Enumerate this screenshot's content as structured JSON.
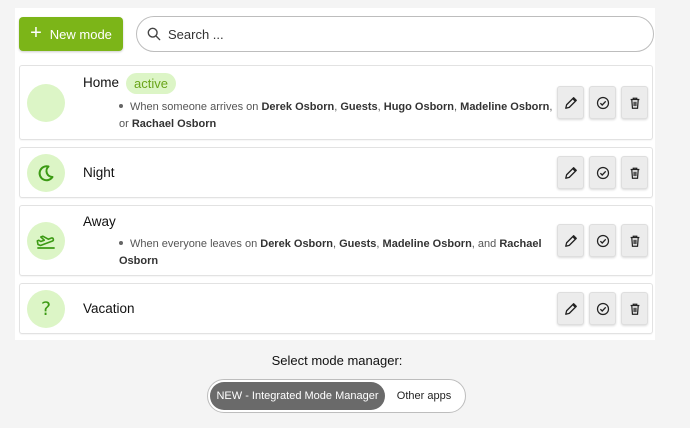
{
  "toolbar": {
    "new_mode_label": "New mode",
    "search_placeholder": "Search ..."
  },
  "modes": [
    {
      "name": "Home",
      "badge": "active",
      "desc_line1_prefix": "When someone arrives on ",
      "desc_names1": [
        "Derek Osborn",
        "Guests",
        "Hugo Osborn",
        "Madeline Osborn"
      ],
      "desc_line2_prefix": "or ",
      "desc_line2_name": "Rachael Osborn",
      "icon": "blank"
    },
    {
      "name": "Night",
      "icon": "moon-icon"
    },
    {
      "name": "Away",
      "desc_line1_prefix": "When everyone leaves on ",
      "desc_line2_name": "Osborn",
      "icon": "plane-departure-icon"
    },
    {
      "name": "Vacation",
      "icon": "question-icon"
    }
  ],
  "home_desc": {
    "t1": "When someone arrives on ",
    "n1": "Derek Osborn",
    "c1": ", ",
    "n2": "Guests",
    "c2": ", ",
    "n3": "Hugo Osborn",
    "c3": ", ",
    "n4": "Madeline Osborn",
    "c4": ",",
    "t2": "or ",
    "n5": "Rachael Osborn"
  },
  "away_desc": {
    "t1": "When everyone leaves on ",
    "n1": "Derek Osborn",
    "c1": ", ",
    "n2": "Guests",
    "c2": ", ",
    "n3": "Madeline Osborn",
    "c3": ", and ",
    "n4": "Rachael",
    "n5": "Osborn"
  },
  "footer": {
    "label": "Select mode manager:",
    "option_active": "NEW - Integrated Mode Manager",
    "option_other": "Other apps"
  },
  "colors": {
    "accent": "#7cb518",
    "icon_bg": "#dcf5c6",
    "icon_fg": "#3c9a14",
    "badge_text": "#6aa51a"
  }
}
